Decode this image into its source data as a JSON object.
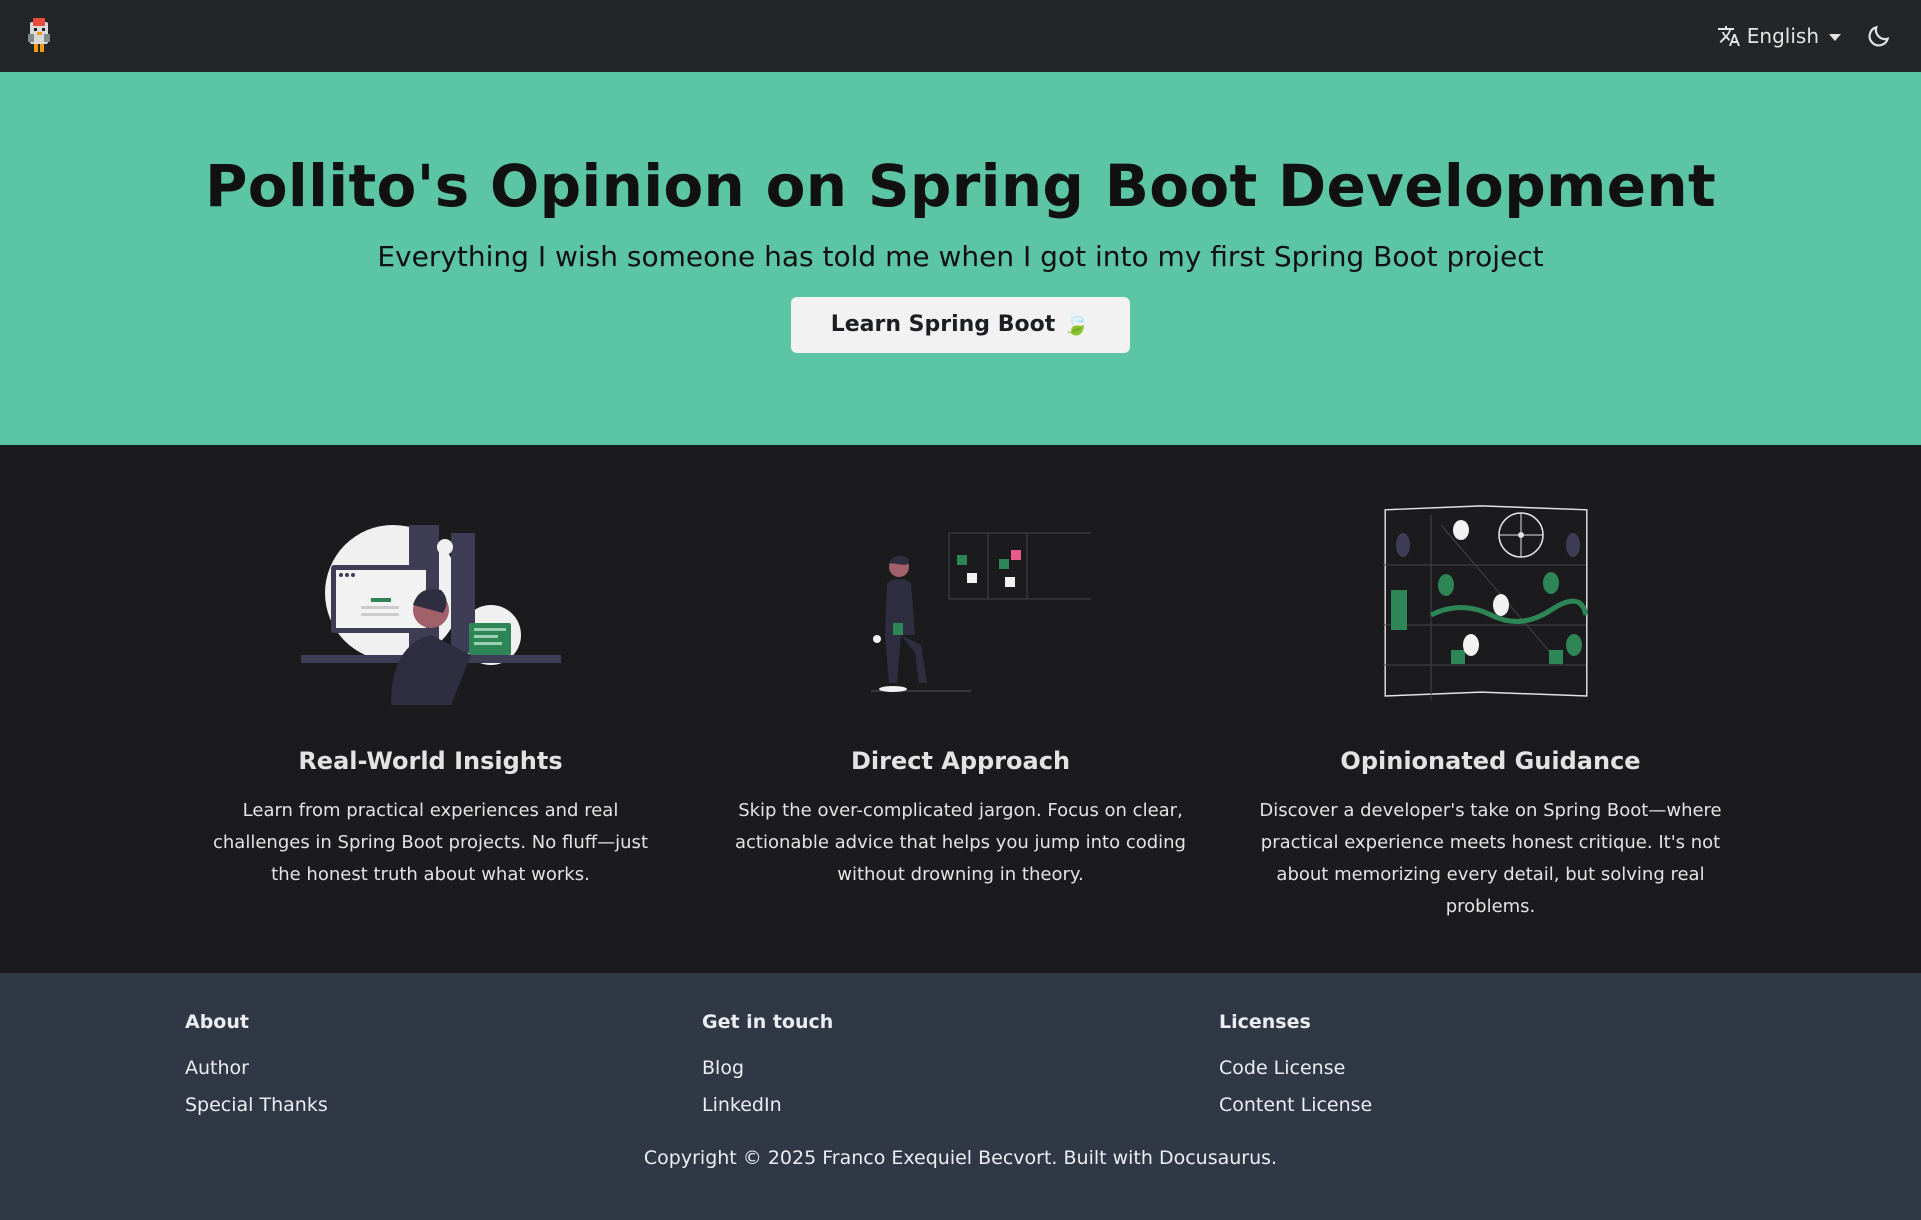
{
  "navbar": {
    "logo_icon": "chicken-logo-icon",
    "language_label": "English",
    "language_icon": "translate-icon",
    "theme_icon": "moon-icon"
  },
  "hero": {
    "title": "Pollito's Opinion on Spring Boot Development",
    "subtitle": "Everything I wish someone has told me when I got into my first Spring Boot project",
    "button_label": "Learn Spring Boot 🍃",
    "background": "#5cc5a4"
  },
  "features": [
    {
      "title": "Real-World Insights",
      "description": "Learn from practical experiences and real challenges in Spring Boot projects. No fluff—just the honest truth about what works.",
      "illustration": "developer-at-computer-illustration"
    },
    {
      "title": "Direct Approach",
      "description": "Skip the over-complicated jargon. Focus on clear, actionable advice that helps you jump into coding without drowning in theory.",
      "illustration": "person-with-task-board-illustration"
    },
    {
      "title": "Opinionated Guidance",
      "description": "Discover a developer's take on Spring Boot—where practical experience meets honest critique. It's not about memorizing every detail, but solving real problems.",
      "illustration": "city-map-illustration"
    }
  ],
  "footer": {
    "columns": [
      {
        "title": "About",
        "links": [
          "Author",
          "Special Thanks"
        ]
      },
      {
        "title": "Get in touch",
        "links": [
          "Blog",
          "LinkedIn"
        ]
      },
      {
        "title": "Licenses",
        "links": [
          "Code License",
          "Content License"
        ]
      }
    ],
    "copyright": "Copyright © 2025 Franco Exequiel Becvort. Built with Docusaurus."
  }
}
